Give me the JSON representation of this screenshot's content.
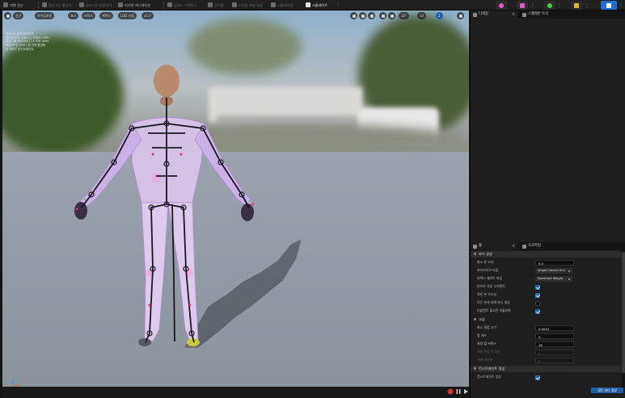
{
  "toolbar": {
    "items": [
      {
        "label": "레벨 생성"
      },
      {
        "label": "플러그인 활성화"
      },
      {
        "label": "플러그인 비활성화"
      },
      {
        "label": "피지컬 애니메이션"
      },
      {
        "label": "블렌드 스페이스"
      },
      {
        "label": "컨트롤"
      },
      {
        "label": "피지컬 애셋 생성"
      },
      {
        "label": "시뮬레이션"
      },
      {
        "label": "시뮬레이트"
      }
    ],
    "colors": {
      "pink": "#e056c8",
      "green": "#47c84a",
      "gold": "#e0b341",
      "blue": "#1f6fd1"
    }
  },
  "viewport": {
    "buttons": [
      {
        "label": "원근"
      },
      {
        "label": "라이팅포함"
      },
      {
        "label": "표시"
      },
      {
        "label": "피직스"
      },
      {
        "label": "캐릭터"
      },
      {
        "label": "LOD 자동"
      },
      {
        "label": "x1.0"
      }
    ],
    "right_buttons": [
      {
        "label": "10°"
      },
      {
        "label": "10"
      },
      {
        "label": "1"
      }
    ],
    "info_lines": [
      "레퍼런스 포즈 미리보기",
      "렌더링 모드: LOD 0 | 카메라 스피드",
      "메시: 28,364 tris | 27,556 verts",
      "애셋 크기: 0.01 | 본 선택 활성화",
      "본 피직스 컨스트레인트"
    ]
  },
  "details_panel": {
    "tabs": [
      {
        "label": "디테일"
      },
      {
        "label": "스켈레톤 트리"
      }
    ]
  },
  "tool_panel": {
    "tabs": [
      {
        "label": "툴"
      },
      {
        "label": "프로파일"
      }
    ],
    "sections": [
      {
        "title": "바디 생성",
        "rows": [
          {
            "label": "최소 본 크기",
            "type": "field",
            "value": "5.0"
          },
          {
            "label": "프리미티브 타입",
            "type": "dropdown",
            "value": "Single Convex Hull"
          },
          {
            "label": "버텍스 웨이트 타입",
            "type": "dropdown",
            "value": "Dominant Weight"
          },
          {
            "label": "본으로 자동 오리엔트",
            "type": "check",
            "checked": true
          },
          {
            "label": "작은 본 가시성",
            "type": "check",
            "checked": true
          },
          {
            "label": "모든 본에 대해 바디 생성",
            "type": "check",
            "checked": false
          },
          {
            "label": "더블렌트 콜리전 비활성화",
            "type": "check",
            "checked": true
          }
        ]
      },
      {
        "title": "고급",
        "rows": [
          {
            "label": "최소 결합 크기",
            "type": "field",
            "value": "0.0001"
          },
          {
            "label": "헐 개수",
            "type": "field",
            "value": "4"
          },
          {
            "label": "최대 헐 버텍스",
            "type": "field",
            "value": "16"
          },
          {
            "label": "제한 직접 적극성",
            "type": "field",
            "value": "0",
            "disabled": true
          },
          {
            "label": "레벨 세분화",
            "type": "field",
            "value": "0",
            "disabled": true
          }
        ]
      },
      {
        "title": "컨스트레인트 생성",
        "rows": [
          {
            "label": "컨스트레인트 생성",
            "type": "check",
            "checked": true
          }
        ]
      }
    ],
    "reset_button": "모든 바디 생성"
  }
}
